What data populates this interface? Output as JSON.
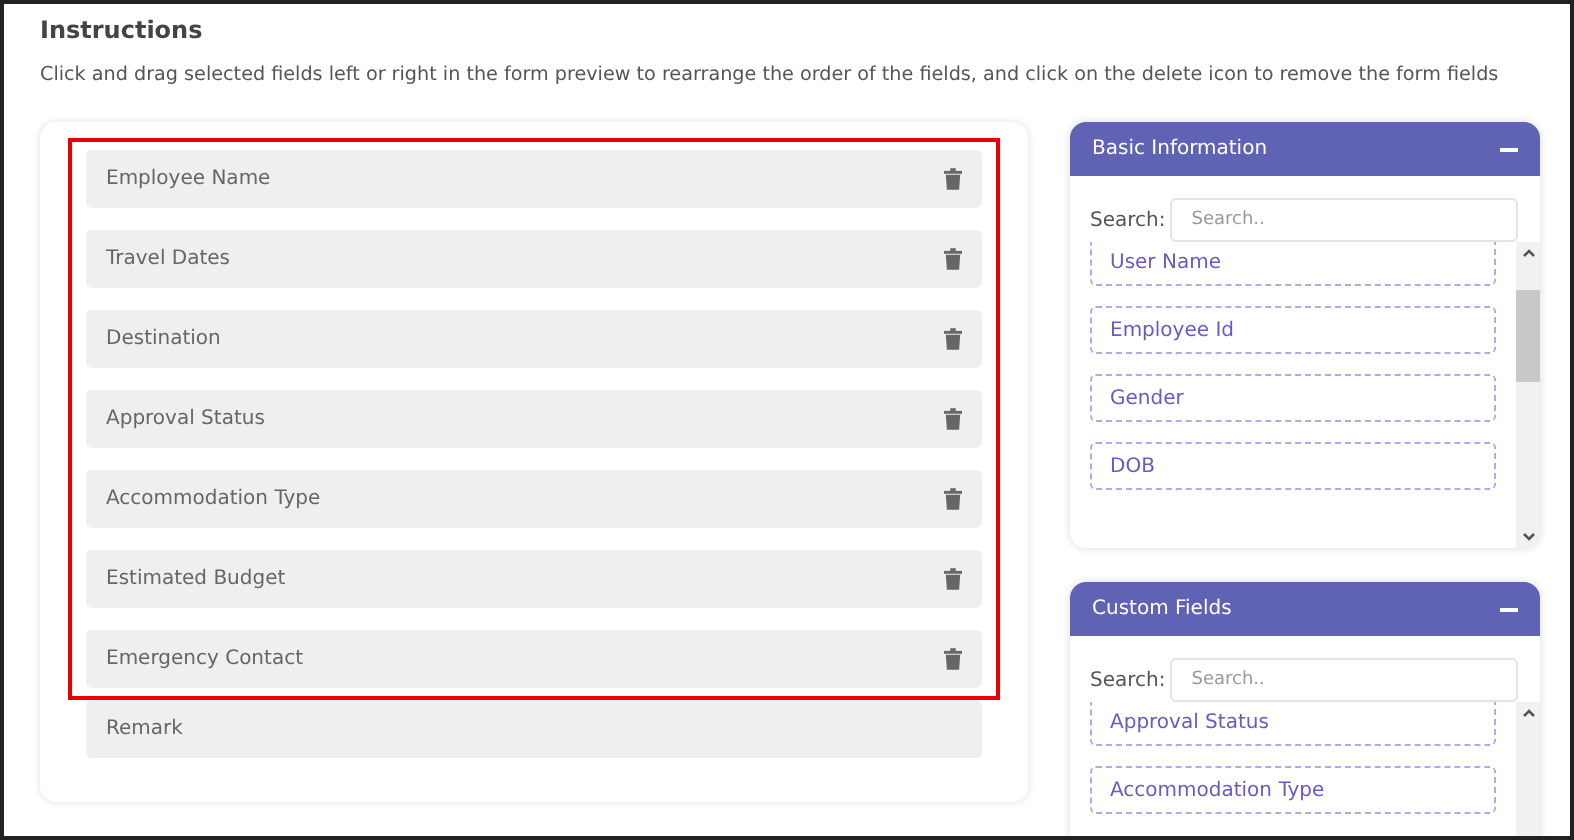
{
  "instructions": {
    "title": "Instructions",
    "text": "Click and drag selected fields left or right in the form preview to rearrange the order of the fields, and click on the delete icon to remove the form fields"
  },
  "form_fields": [
    {
      "label": "Employee Name",
      "highlighted": true,
      "deletable": true
    },
    {
      "label": "Travel Dates",
      "highlighted": true,
      "deletable": true
    },
    {
      "label": "Destination",
      "highlighted": true,
      "deletable": true
    },
    {
      "label": "Approval Status",
      "highlighted": true,
      "deletable": true
    },
    {
      "label": "Accommodation Type",
      "highlighted": true,
      "deletable": true
    },
    {
      "label": "Estimated Budget",
      "highlighted": true,
      "deletable": true
    },
    {
      "label": "Emergency Contact",
      "highlighted": true,
      "deletable": true
    },
    {
      "label": "Remark",
      "highlighted": false,
      "deletable": false
    }
  ],
  "panels": [
    {
      "title": "Basic Information",
      "expanded": true,
      "search_label": "Search:",
      "search_placeholder": "Search..",
      "items": [
        "User Name",
        "Employee Id",
        "Gender",
        "DOB"
      ]
    },
    {
      "title": "Custom Fields",
      "expanded": true,
      "search_label": "Search:",
      "search_placeholder": "Search..",
      "items": [
        "Approval Status",
        "Accommodation Type"
      ]
    }
  ]
}
